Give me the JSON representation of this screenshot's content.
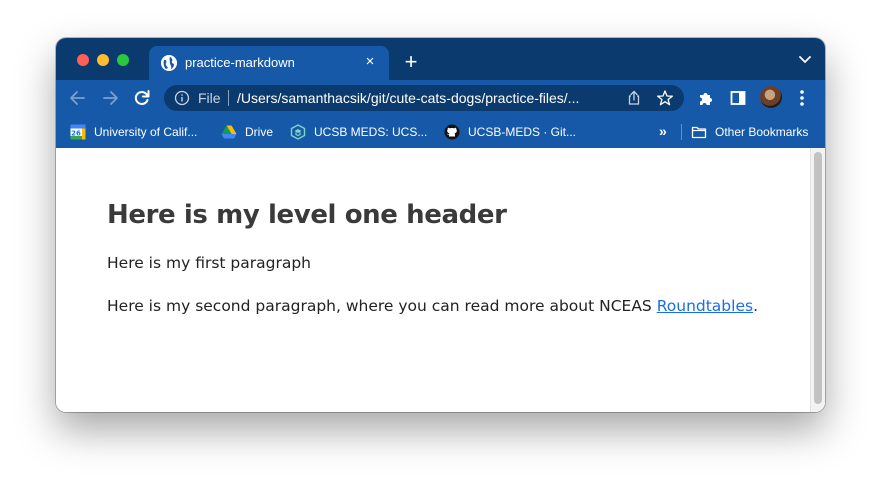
{
  "browser": {
    "tab": {
      "title": "practice-markdown",
      "close_glyph": "×"
    },
    "new_tab_glyph": "+",
    "omnibox": {
      "scheme_label": "File",
      "url": "/Users/samanthacsik/git/cute-cats-dogs/practice-files/..."
    },
    "bookmarks": [
      {
        "label": "University of Calif...",
        "icon": "calendar-26-icon"
      },
      {
        "label": "Drive",
        "icon": "google-drive-icon"
      },
      {
        "label": "UCSB MEDS: UCS...",
        "icon": "meds-icon"
      },
      {
        "label": "UCSB-MEDS · Git...",
        "icon": "github-icon"
      }
    ],
    "bookmarks_overflow": "»",
    "other_bookmarks": {
      "label": "Other Bookmarks",
      "icon": "folder-icon"
    },
    "calendar_badge": "26",
    "colors": {
      "frame": "#0b3a6e",
      "toolbar": "#1559a8",
      "link": "#1a6ee8"
    }
  },
  "document": {
    "heading": "Here is my level one header",
    "paragraph1": "Here is my first paragraph",
    "paragraph2_before": "Here is my second paragraph, where you can read more about NCEAS ",
    "paragraph2_link": "Roundtables",
    "paragraph2_after": "."
  }
}
